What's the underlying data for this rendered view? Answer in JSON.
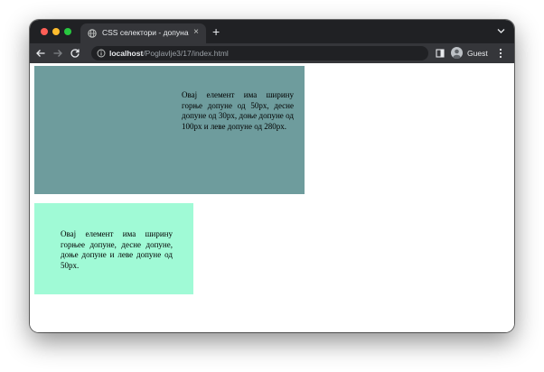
{
  "browser": {
    "tab": {
      "title": "CSS селектори - допуна",
      "close_glyph": "×",
      "favicon_icon": "globe-icon"
    },
    "new_tab_glyph": "+",
    "address_bar": {
      "host": "localhost",
      "path": "/Poglavlje3/17/index.html",
      "info_icon": "info-icon"
    },
    "profile": {
      "label": "Guest",
      "icon": "person-icon"
    },
    "icons": {
      "back": "arrow-left-icon",
      "forward": "arrow-right-icon",
      "reload": "reload-icon",
      "side_panel": "side-panel-icon",
      "menu": "three-dots-vertical-icon",
      "tab_search": "chevron-down-icon"
    }
  },
  "page": {
    "box1": {
      "text": "Овај елемент има ширину горње допуне од 50px, десне допуне од 30px, доње допуне од 100px и леве допуне од 280px.",
      "background": "#6e9c9d"
    },
    "box2": {
      "text": "Овај елемент има ширину горњее допуне, десне допуне, доње допуне и леве допуне од 50px.",
      "background": "#a0fad6"
    }
  },
  "colors": {
    "frame": "#202124",
    "toolbar": "#35363a",
    "traffic_red": "#ff5f57",
    "traffic_yellow": "#febc2e",
    "traffic_green": "#28c840"
  }
}
